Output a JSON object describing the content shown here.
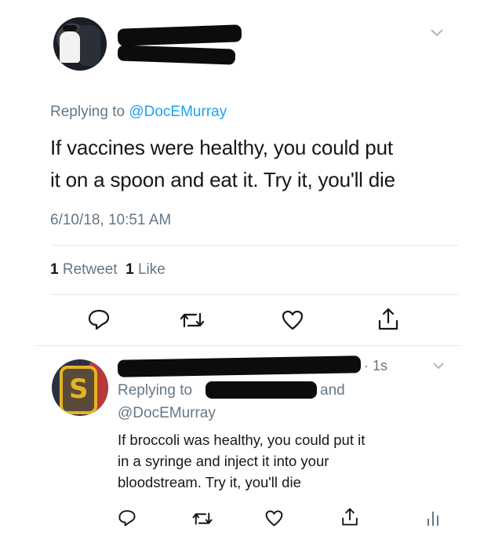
{
  "tweet": {
    "replying_prefix": "Replying to",
    "replying_handle": "@DocEMurray",
    "text_line1": "If vaccines were healthy, you could put",
    "text_line2": "it on a spoon and eat it. Try it, you'll die",
    "timestamp": "6/10/18, 10:51 AM",
    "retweet_count": "1",
    "retweet_label": "Retweet",
    "like_count": "1",
    "like_label": "Like"
  },
  "reply": {
    "time": "· 1s",
    "replying_prefix": "Replying to",
    "and_label": "and",
    "handle": "@DocEMurray",
    "text_line1": "If broccoli was healthy, you could put it",
    "text_line2": "in a syringe and inject it into your",
    "text_line3": "bloodstream. Try it, you'll die"
  },
  "icons": {
    "chevron": "chevron-down-icon",
    "reply": "reply-icon",
    "retweet": "retweet-icon",
    "like": "heart-icon",
    "share": "share-icon",
    "analytics": "analytics-icon"
  },
  "colors": {
    "link": "#1da1f2",
    "secondary": "#657786",
    "text": "#14171a",
    "divider": "#e1e8ed"
  }
}
